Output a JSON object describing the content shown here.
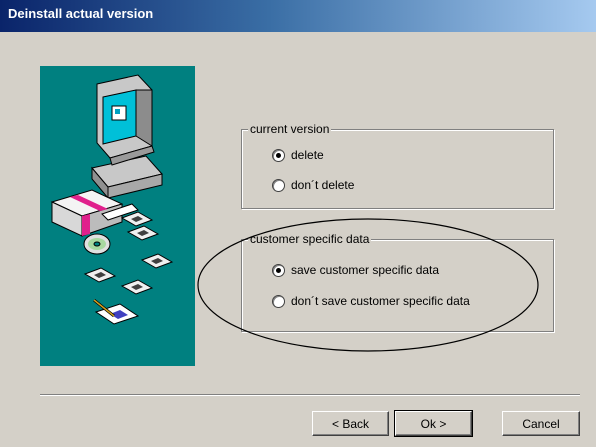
{
  "window": {
    "title": "Deinstall actual version"
  },
  "current_version": {
    "title": "current version",
    "options": [
      {
        "label": "delete",
        "checked": true
      },
      {
        "label": "don´t delete",
        "checked": false
      }
    ]
  },
  "customer_data": {
    "title": "customer specific data",
    "options": [
      {
        "label": "save customer specific data",
        "checked": true
      },
      {
        "label": "don´t save customer specific data",
        "checked": false
      }
    ]
  },
  "buttons": {
    "back": "< Back",
    "ok": "Ok >",
    "cancel": "Cancel"
  },
  "colors": {
    "titlebar_start": "#0a246a",
    "titlebar_end": "#a6caf0",
    "face": "#d4d0c8",
    "illustration_bg": "#008080"
  },
  "icons": [
    "computer-icon",
    "install-box-icon",
    "floppy-disk-icon",
    "cd-icon",
    "document-pen-icon"
  ]
}
